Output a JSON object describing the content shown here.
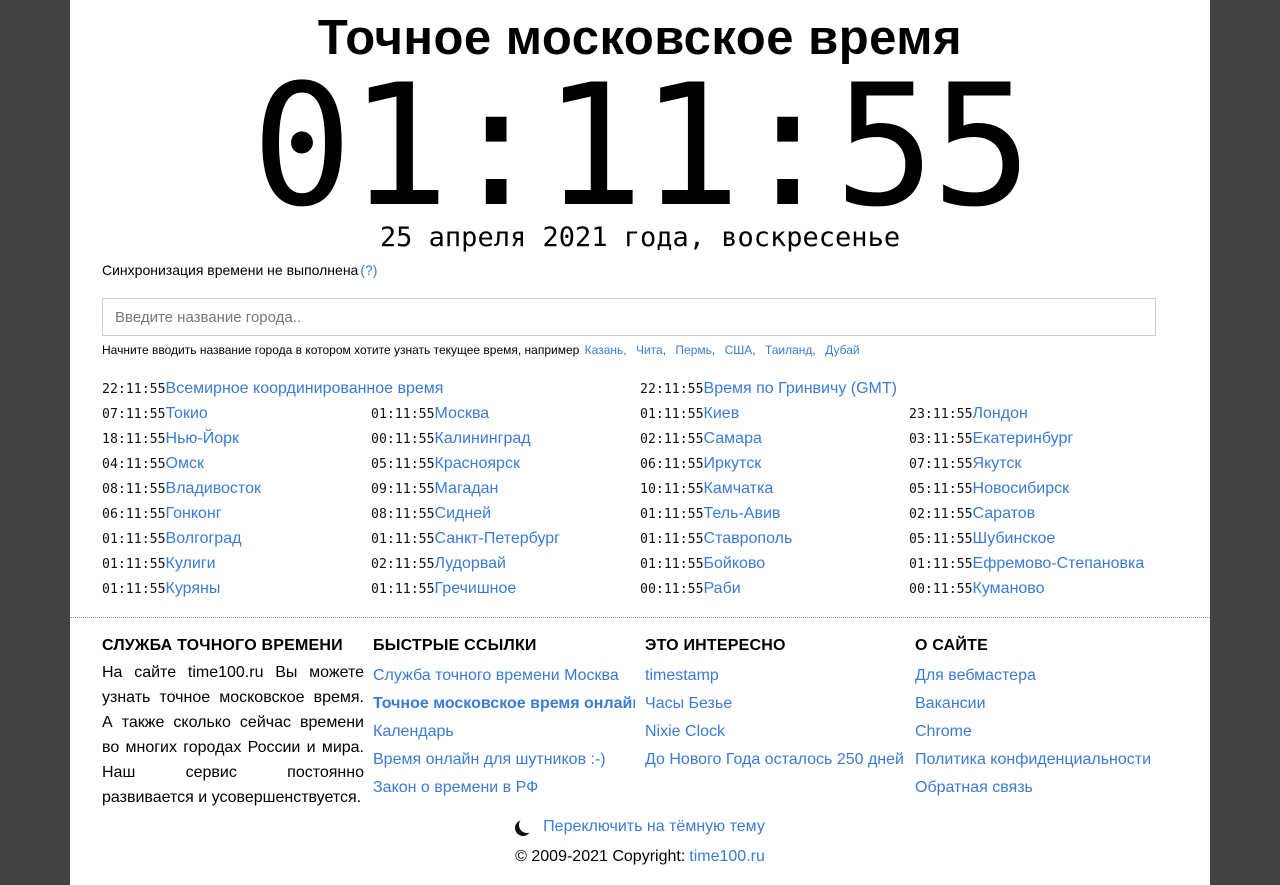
{
  "title": "Точное московское время",
  "clock": "01:11:55",
  "date": "25 апреля 2021 года, воскресенье",
  "sync": {
    "text": "Синхронизация времени не выполнена",
    "help": "(?)"
  },
  "search": {
    "placeholder": "Введите название города..",
    "value": ""
  },
  "hint": {
    "text": "Начните вводить название города в котором хотите узнать текущее время, например",
    "examples": [
      "Казань",
      "Чита",
      "Пермь",
      "США",
      "Таиланд",
      "Дубай"
    ]
  },
  "zones": {
    "top": [
      {
        "time": "22:11:55",
        "label": "Всемирное координированное время"
      },
      {
        "time": "22:11:55",
        "label": "Время по Гринвичу (GMT)"
      }
    ],
    "grid": [
      [
        {
          "time": "07:11:55",
          "label": "Токио"
        },
        {
          "time": "01:11:55",
          "label": "Москва"
        },
        {
          "time": "01:11:55",
          "label": "Киев"
        },
        {
          "time": "23:11:55",
          "label": "Лондон"
        }
      ],
      [
        {
          "time": "18:11:55",
          "label": "Нью-Йорк"
        },
        {
          "time": "00:11:55",
          "label": "Калининград"
        },
        {
          "time": "02:11:55",
          "label": "Самара"
        },
        {
          "time": "03:11:55",
          "label": "Екатеринбург"
        }
      ],
      [
        {
          "time": "04:11:55",
          "label": "Омск"
        },
        {
          "time": "05:11:55",
          "label": "Красноярск"
        },
        {
          "time": "06:11:55",
          "label": "Иркутск"
        },
        {
          "time": "07:11:55",
          "label": "Якутск"
        }
      ],
      [
        {
          "time": "08:11:55",
          "label": "Владивосток"
        },
        {
          "time": "09:11:55",
          "label": "Магадан"
        },
        {
          "time": "10:11:55",
          "label": "Камчатка"
        },
        {
          "time": "05:11:55",
          "label": "Новосибирск"
        }
      ],
      [
        {
          "time": "06:11:55",
          "label": "Гонконг"
        },
        {
          "time": "08:11:55",
          "label": "Сидней"
        },
        {
          "time": "01:11:55",
          "label": "Тель-Авив"
        },
        {
          "time": "02:11:55",
          "label": "Саратов"
        }
      ],
      [
        {
          "time": "01:11:55",
          "label": "Волгоград"
        },
        {
          "time": "01:11:55",
          "label": "Санкт-Петербург"
        },
        {
          "time": "01:11:55",
          "label": "Ставрополь"
        },
        {
          "time": "05:11:55",
          "label": "Шубинское"
        }
      ],
      [
        {
          "time": "01:11:55",
          "label": "Кулиги"
        },
        {
          "time": "02:11:55",
          "label": "Лудорвай"
        },
        {
          "time": "01:11:55",
          "label": "Бойково"
        },
        {
          "time": "01:11:55",
          "label": "Ефремово-Степановка"
        }
      ],
      [
        {
          "time": "01:11:55",
          "label": "Куряны"
        },
        {
          "time": "01:11:55",
          "label": "Гречишное"
        },
        {
          "time": "00:11:55",
          "label": "Раби"
        },
        {
          "time": "00:11:55",
          "label": "Куманово"
        }
      ]
    ]
  },
  "footer": {
    "service": {
      "heading": "СЛУЖБА ТОЧНОГО ВРЕМЕНИ",
      "text": "На сайте time100.ru Вы можете узнать точное московское время. А также сколько сейчас времени во многих городах России и мира. Наш сервис постоянно развивается и усовершенствуется."
    },
    "quick": {
      "heading": "БЫСТРЫЕ ССЫЛКИ",
      "links": [
        "Служба точного времени Москва",
        "Точное московское время онлайн",
        "Календарь",
        "Время онлайн для шутников :-)",
        "Закон о времени в РФ"
      ]
    },
    "interesting": {
      "heading": "ЭТО ИНТЕРЕСНО",
      "links": [
        "timestamp",
        "Часы Безье",
        "Nixie Clock",
        "До Нового Года осталось 250 дней"
      ]
    },
    "about": {
      "heading": "О САЙТЕ",
      "links": [
        "Для вебмастера",
        "Вакансии",
        "Chrome",
        "Политика конфиденциальности",
        "Обратная связь"
      ]
    }
  },
  "theme_toggle": {
    "icon": "moon-icon",
    "label": "Переключить на тёмную тему"
  },
  "copyright": {
    "text": "© 2009-2021 Copyright:",
    "link": "time100.ru"
  },
  "colors": {
    "link": "#3a7bd5",
    "frame": "#424242"
  }
}
